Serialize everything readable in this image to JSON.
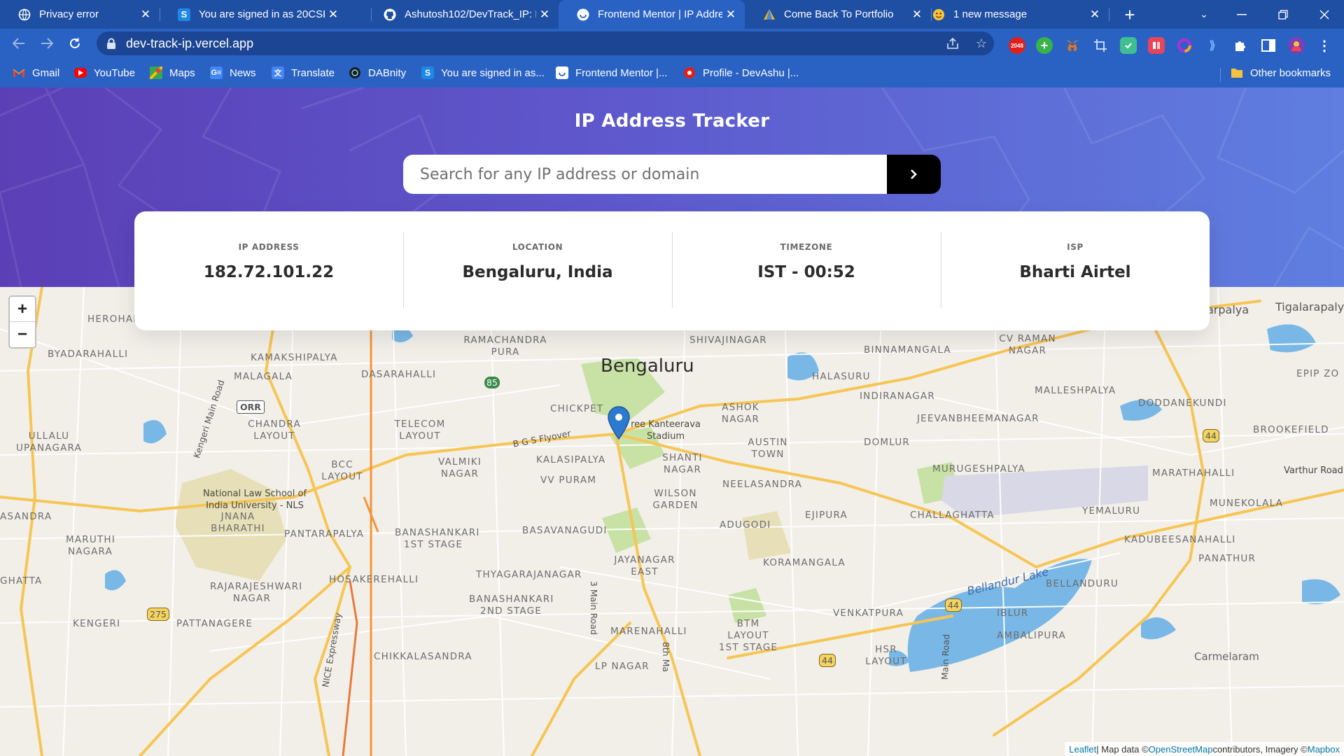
{
  "browser": {
    "tabs": [
      {
        "title": "Privacy error",
        "icon": "globe-icon"
      },
      {
        "title": "You are signed in as 20CSE",
        "icon": "s-icon"
      },
      {
        "title": "Ashutosh102/DevTrack_IP: I",
        "icon": "github-icon"
      },
      {
        "title": "Frontend Mentor | IP Addre",
        "icon": "frontend-mentor-icon",
        "active": true
      },
      {
        "title": "Come Back To Portfolio",
        "icon": "triangle-icon"
      },
      {
        "title": "1 new message",
        "icon": "emoji-icon"
      }
    ],
    "url": "dev-track-ip.vercel.app",
    "bookmarks": [
      {
        "label": "Gmail",
        "icon": "gmail-icon"
      },
      {
        "label": "YouTube",
        "icon": "youtube-icon"
      },
      {
        "label": "Maps",
        "icon": "maps-icon"
      },
      {
        "label": "News",
        "icon": "news-icon"
      },
      {
        "label": "Translate",
        "icon": "translate-icon"
      },
      {
        "label": "DABnity",
        "icon": "dabnity-icon"
      },
      {
        "label": "You are signed in as...",
        "icon": "s-icon"
      },
      {
        "label": "Frontend Mentor |...",
        "icon": "frontend-mentor-icon"
      },
      {
        "label": "Profile - DevAshu |...",
        "icon": "profile-icon"
      }
    ],
    "other_bookmarks": "Other bookmarks",
    "extensions": [
      {
        "label": "2048",
        "color": "#e0201b"
      },
      {
        "label": "+",
        "color": "#37b34a"
      },
      {
        "label": "fox",
        "color": "#e2761b"
      },
      {
        "label": "",
        "color": "#2a62c4"
      },
      {
        "label": "",
        "color": "#3fbf8f"
      },
      {
        "label": "",
        "color": "#e8445a"
      },
      {
        "label": "",
        "color": "#b02fd0"
      }
    ]
  },
  "page": {
    "title": "IP Address Tracker",
    "search": {
      "placeholder": "Search for any IP address or domain",
      "value": "",
      "button": ">"
    },
    "info": [
      {
        "label": "IP ADDRESS",
        "value": "182.72.101.22"
      },
      {
        "label": "LOCATION",
        "value": "Bengaluru, India"
      },
      {
        "label": "TIMEZONE",
        "value": "IST - 00:52"
      },
      {
        "label": "ISP",
        "value": "Bharti Airtel"
      }
    ],
    "zoom": {
      "in": "+",
      "out": "−"
    },
    "attribution": {
      "leaflet": "Leaflet",
      "sep": " | Map data © ",
      "osm": "OpenStreetMap",
      "mid": " contributors, Imagery © ",
      "mapbox": "Mapbox"
    }
  },
  "map": {
    "city": "Bengaluru",
    "labels": [
      "HEROHALLI",
      "BYADARAHALLI",
      "KAMAKSHIPALYA",
      "MALAGALA",
      "DASARAHALLI",
      "RAMACHANDRA PURA",
      "SHIVAJINAGAR",
      "BINNAMANGALA",
      "CV RAMAN NAGAR",
      "HALASURU",
      "INDIRANAGAR",
      "MALLESHPALYA",
      "DODDANEKUNDI",
      "EPIP ZO",
      "Tigalarapaly",
      "arpalya",
      "JEEVANBHEEMANAGAR",
      "BROOKEFIELD",
      "CHICKPET",
      "ASHOK NAGAR",
      "ree Kanteerava Stadium",
      "TELECOM LAYOUT",
      "CHANDRA LAYOUT",
      "ULLALU UPANAGARA",
      "AUSTIN TOWN",
      "DOMLUR",
      "MURUGESHPALYA",
      "MARATHAHALLI",
      "Varthur Road",
      "KALASIPALYA",
      "VALMIKI NAGAR",
      "SHANTI NAGAR",
      "BCC LAYOUT",
      "VV PURAM",
      "WILSON GARDEN",
      "NEELASANDRA",
      "MUNEKOLALA",
      "National Law School of India University - NLS",
      "JNANA BHARATHI",
      "EJIPURA",
      "CHALLAGHATTA",
      "YEMALURU",
      "ASANDRA",
      "ADUGODI",
      "PANTARAPALYA",
      "BANASHANKARI 1ST STAGE",
      "BASAVANAGUDI",
      "MARUTHI NAGARA",
      "KADUBEESANAHALLI",
      "JAYANAGAR EAST",
      "KORAMANGALA",
      "PANATHUR",
      "THYAGARAJANAGAR",
      "HOSAKEREHALLI",
      "Bellandur Lake",
      "GHATTA",
      "RAJARAJESHWARI NAGAR",
      "BELLANDURU",
      "BANASHANKARI 2ND STAGE",
      "VENKATPURA",
      "IBLUR",
      "KENGERI",
      "PATTANAGERE",
      "MARENAHALLI",
      "BTM LAYOUT 1ST STAGE",
      "AMBALIPURA",
      "CHIKKALASANDRA",
      "HSR LAYOUT",
      "LP NAGAR",
      "Kengeri Main Road",
      "B G S Flyover",
      "NICE Expressway",
      "3 Main Road",
      "8th Ma",
      "Main Road",
      "Carmelaram"
    ],
    "shields": [
      "85",
      "85",
      "ORR",
      "44",
      "44",
      "275",
      "44"
    ]
  },
  "colors": {
    "tabstrip": "#1f4fa3",
    "toolbar": "#2a62c4",
    "hero_start": "#5b3fb6",
    "hero_end": "#5f7ee0",
    "water": "#79b8e6",
    "park": "#c7e2a4",
    "road_major": "#f6c554",
    "map_land": "#f2efe9",
    "marker": "#2c7ad0"
  }
}
